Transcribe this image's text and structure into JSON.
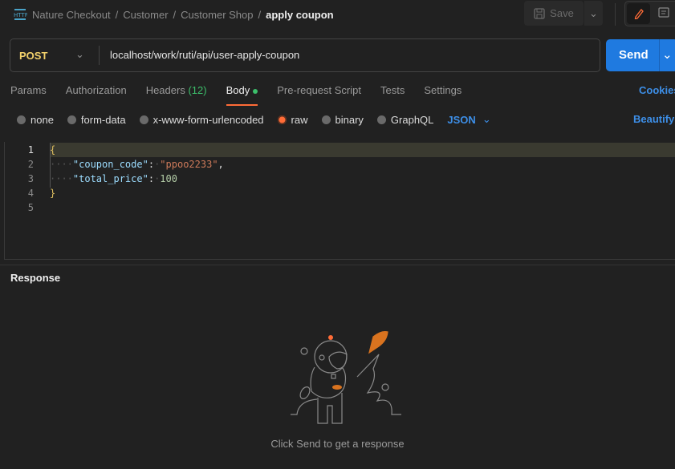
{
  "header": {
    "breadcrumbs": [
      "Nature Checkout",
      "Customer",
      "Customer Shop"
    ],
    "current": "apply coupon",
    "save_label": "Save",
    "icon": "http-icon"
  },
  "request": {
    "method": "POST",
    "url": "localhost/work/ruti/api/user-apply-coupon",
    "send_label": "Send"
  },
  "tabs": {
    "params": "Params",
    "authorization": "Authorization",
    "headers": "Headers",
    "headers_count": "(12)",
    "body": "Body",
    "prerequest": "Pre-request Script",
    "tests": "Tests",
    "settings": "Settings",
    "cookies": "Cookies"
  },
  "body_types": {
    "none": "none",
    "form_data": "form-data",
    "urlencoded": "x-www-form-urlencoded",
    "raw": "raw",
    "binary": "binary",
    "graphql": "GraphQL",
    "selected": "raw",
    "format": "JSON",
    "beautify": "Beautify"
  },
  "editor": {
    "line_numbers": [
      "1",
      "2",
      "3",
      "4",
      "5"
    ],
    "open": "{",
    "close": "}",
    "key1": "\"coupon_code\"",
    "val1": "\"ppoo2233\"",
    "key2": "\"total_price\"",
    "val2": "100"
  },
  "response": {
    "title": "Response",
    "hint": "Click Send to get a response"
  },
  "colors": {
    "accent": "#ff6c37",
    "send": "#1f7ae0",
    "link": "#3d8fe8",
    "method": "#f2d16b"
  }
}
